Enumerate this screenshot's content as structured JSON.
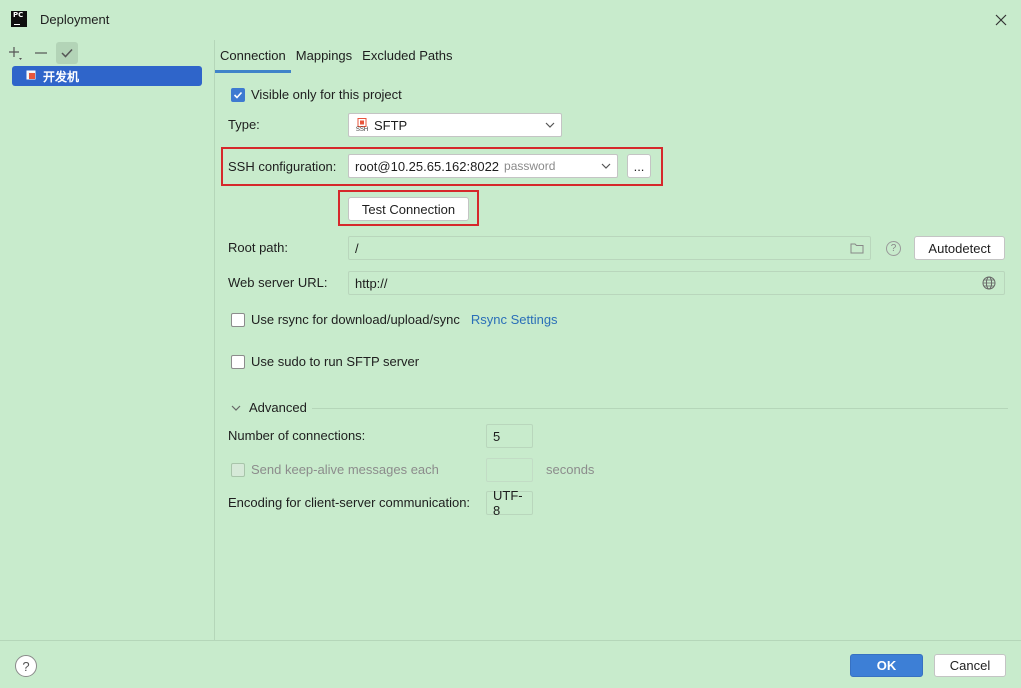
{
  "window": {
    "title": "Deployment",
    "app_icon_text": "PC"
  },
  "left_panel": {
    "toolbar": [
      "add-icon",
      "remove-icon",
      "check-icon"
    ],
    "servers": [
      {
        "label": "开发机",
        "selected": true
      }
    ]
  },
  "tabs": [
    {
      "label": "Connection",
      "selected": true
    },
    {
      "label": "Mappings",
      "selected": false
    },
    {
      "label": "Excluded Paths",
      "selected": false
    }
  ],
  "connection": {
    "visible_only_label": "Visible only for this project",
    "visible_only_checked": true,
    "type_label": "Type:",
    "type_value": "SFTP",
    "type_icon_text": "SSH",
    "ssh_label": "SSH configuration:",
    "ssh_value": "root@10.25.65.162:8022",
    "ssh_auth": "password",
    "ssh_more_button": "...",
    "test_connection_button": "Test Connection",
    "root_path_label": "Root path:",
    "root_path_value": "/",
    "autodetect_button": "Autodetect",
    "help_mark": "?",
    "web_url_label": "Web server URL:",
    "web_url_value": "http://",
    "rsync_label": "Use rsync for download/upload/sync",
    "rsync_checked": false,
    "rsync_settings_link": "Rsync Settings",
    "sudo_label": "Use sudo to run SFTP server",
    "sudo_checked": false
  },
  "advanced": {
    "header": "Advanced",
    "connections_label": "Number of connections:",
    "connections_value": "5",
    "keepalive_label": "Send keep-alive messages each",
    "keepalive_checked": false,
    "keepalive_value": "",
    "keepalive_unit": "seconds",
    "encoding_label": "Encoding for client-server communication:",
    "encoding_value": "UTF-8"
  },
  "footer": {
    "help_mark": "?",
    "ok_button": "OK",
    "cancel_button": "Cancel"
  },
  "colors": {
    "background": "#c8ebcc",
    "accent": "#3d7fd6",
    "highlight_frame": "#d6282b",
    "selection": "#2f65ca"
  }
}
